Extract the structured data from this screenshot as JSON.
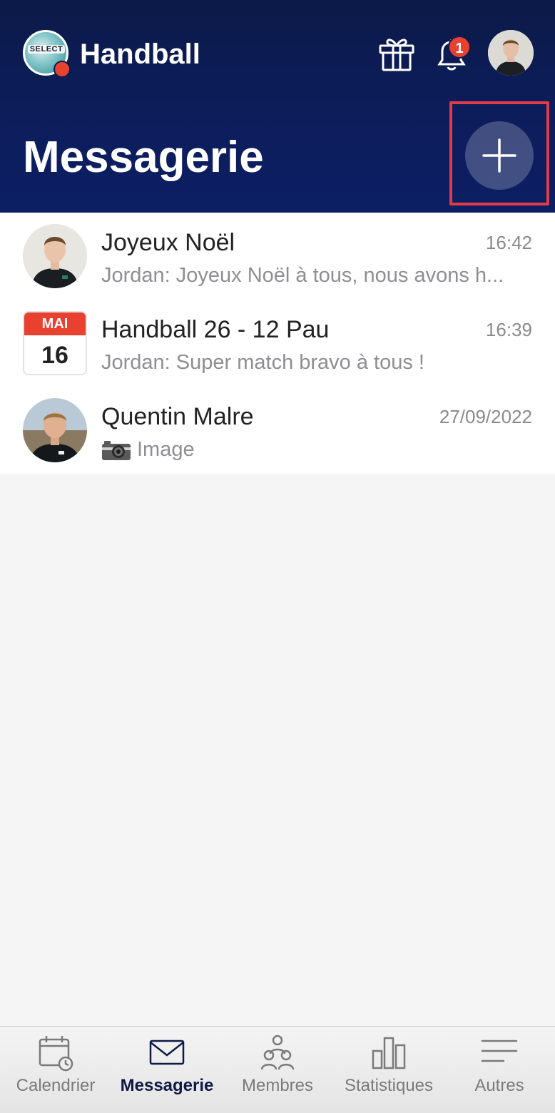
{
  "header": {
    "club_name": "Handball",
    "club_logo_text": "SELECT",
    "notifications_count": "1",
    "page_title": "Messagerie"
  },
  "conversations": [
    {
      "title": "Joyeux Noël",
      "time": "16:42",
      "preview": "Jordan: Joyeux Noël à tous, nous avons h..."
    },
    {
      "title": "Handball 26 - 12 Pau",
      "time": "16:39",
      "preview": "Jordan: Super match bravo à tous !",
      "calendar_month": "MAI",
      "calendar_day": "16"
    },
    {
      "title": "Quentin Malre",
      "time": "27/09/2022",
      "preview": "Image"
    }
  ],
  "tabs": [
    {
      "label": "Calendrier",
      "icon": "calendar-icon"
    },
    {
      "label": "Messagerie",
      "icon": "envelope-icon",
      "active": true
    },
    {
      "label": "Membres",
      "icon": "members-icon"
    },
    {
      "label": "Statistiques",
      "icon": "bar-chart-icon"
    },
    {
      "label": "Autres",
      "icon": "menu-lines-icon"
    }
  ],
  "colors": {
    "header_bg": "#0c1f63",
    "accent_red": "#e8412f",
    "highlight_box": "#e23b47",
    "active_tab": "#0e1a45"
  }
}
